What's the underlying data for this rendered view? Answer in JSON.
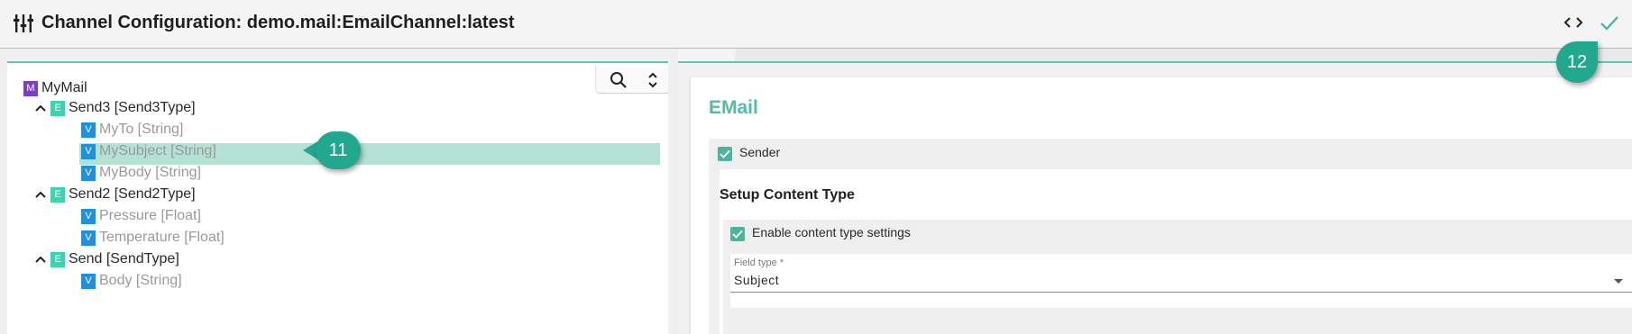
{
  "header": {
    "title": "Channel Configuration: demo.mail:EmailChannel:latest",
    "title_icon": "equalizer-icon",
    "code_icon": "code-brackets-icon",
    "confirm_icon": "checkmark-icon"
  },
  "tree": {
    "tools": {
      "search_icon": "search-icon",
      "sort_icon": "expand-collapse-icon"
    },
    "root": {
      "badge": "M",
      "label": "MyMail"
    },
    "groups": [
      {
        "badge": "E",
        "label": "Send3 [Send3Type]",
        "children": [
          {
            "badge": "V",
            "label": "MyTo [String]"
          },
          {
            "badge": "V",
            "label": "MySubject [String]",
            "selected": true
          },
          {
            "badge": "V",
            "label": "MyBody [String]"
          }
        ]
      },
      {
        "badge": "E",
        "label": "Send2 [Send2Type]",
        "children": [
          {
            "badge": "V",
            "label": "Pressure [Float]"
          },
          {
            "badge": "V",
            "label": "Temperature [Float]"
          }
        ]
      },
      {
        "badge": "E",
        "label": "Send [SendType]",
        "children": [
          {
            "badge": "V",
            "label": "Body [String]"
          }
        ]
      }
    ]
  },
  "callouts": {
    "first": "11",
    "second": "12"
  },
  "detail": {
    "section_title": "EMail",
    "sender": {
      "label": "Sender",
      "checked": true
    },
    "setup_title": "Setup Content Type",
    "enable": {
      "label": "Enable content type settings",
      "checked": true
    },
    "field_type": {
      "label": "Field type *",
      "value": "Subject"
    }
  },
  "colors": {
    "accent": "#4cbfa4",
    "callout": "#20a98e",
    "selection": "#b3e2d4",
    "badge_m": "#7b3fc7",
    "badge_e": "#38d6b0",
    "badge_v": "#1e90e0"
  }
}
